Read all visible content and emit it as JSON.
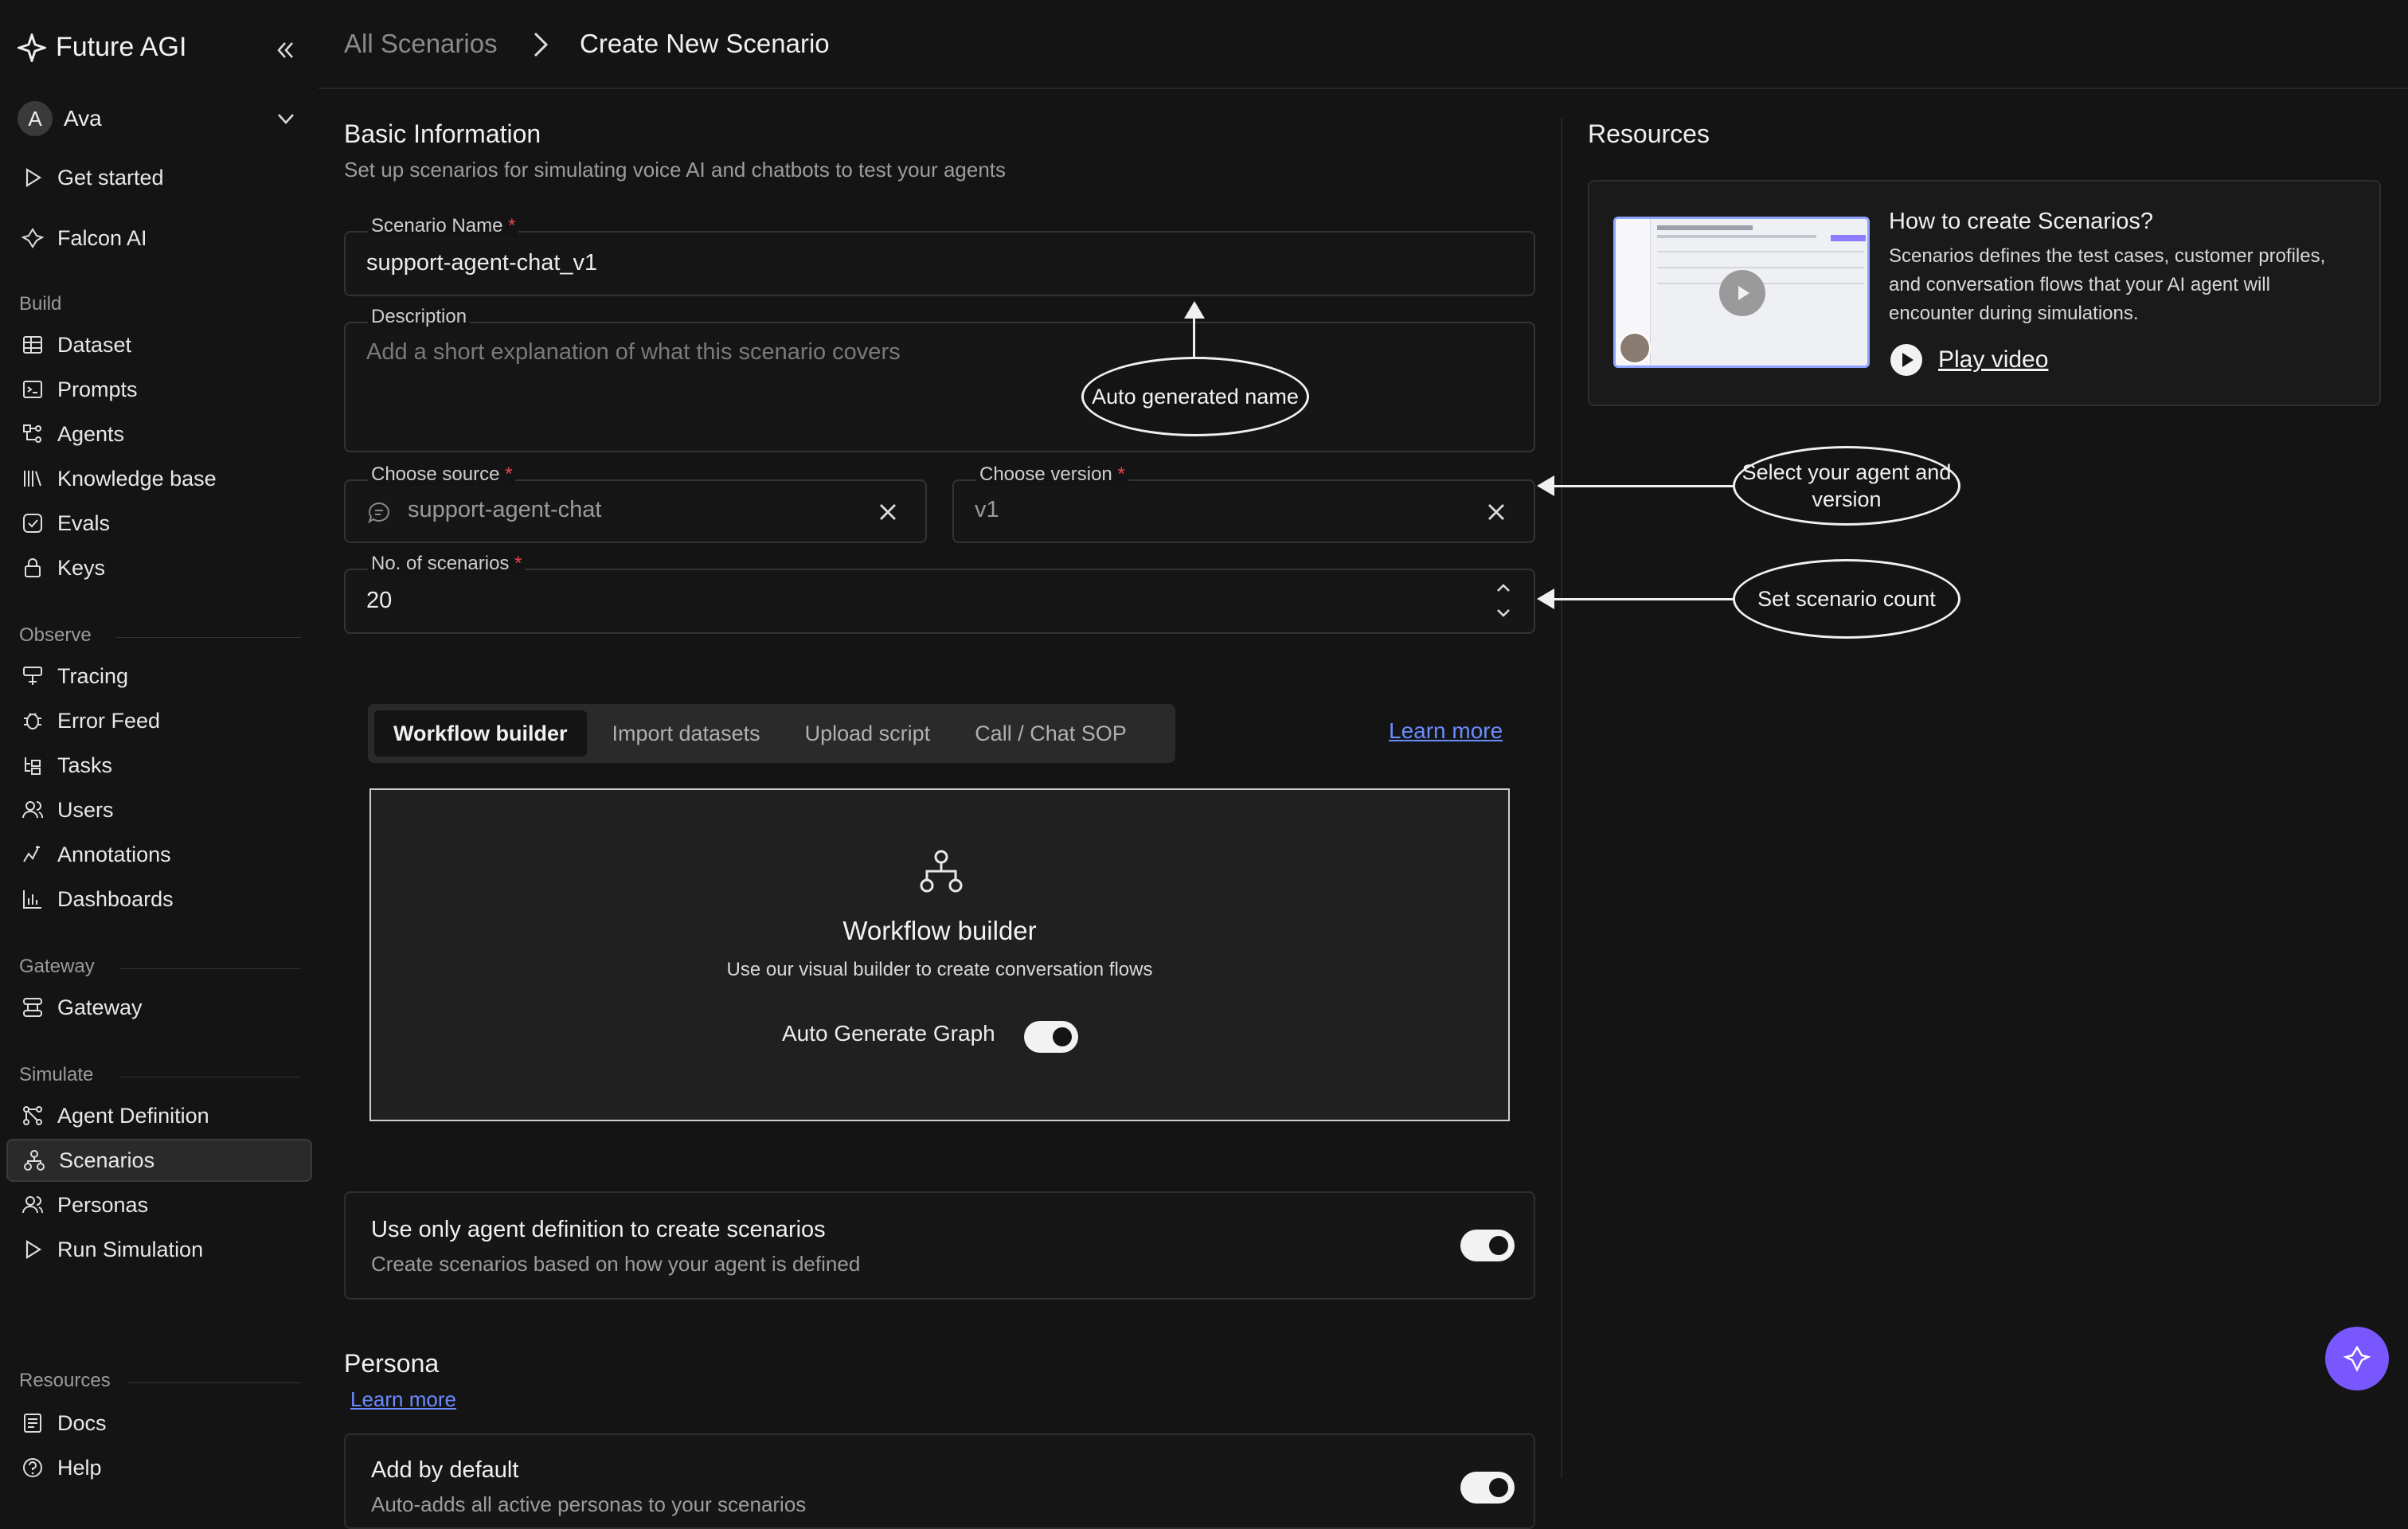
{
  "app": {
    "name": "Future AGI"
  },
  "user": {
    "initial": "A",
    "name": "Ava"
  },
  "nav": {
    "get_started": "Get started",
    "falcon": "Falcon AI",
    "build_label": "Build",
    "build": [
      "Dataset",
      "Prompts",
      "Agents",
      "Knowledge base",
      "Evals",
      "Keys"
    ],
    "observe_label": "Observe",
    "observe": [
      "Tracing",
      "Error Feed",
      "Tasks",
      "Users",
      "Annotations",
      "Dashboards"
    ],
    "gateway_label": "Gateway",
    "gateway": [
      "Gateway"
    ],
    "simulate_label": "Simulate",
    "simulate": [
      "Agent Definition",
      "Scenarios",
      "Personas",
      "Run Simulation"
    ],
    "resources_label": "Resources",
    "resources": [
      "Docs",
      "Help"
    ]
  },
  "breadcrumb": {
    "parent": "All Scenarios",
    "current": "Create New Scenario"
  },
  "basic": {
    "title": "Basic Information",
    "subtitle": "Set up scenarios for simulating voice AI and chatbots to test your agents",
    "name_label": "Scenario Name",
    "name_value": "support-agent-chat_v1",
    "desc_label": "Description",
    "desc_placeholder": "Add a short explanation of what this scenario covers",
    "source_label": "Choose source",
    "source_value": "support-agent-chat",
    "version_label": "Choose version",
    "version_value": "v1",
    "count_label": "No. of scenarios",
    "count_value": "20",
    "required_mark": "*"
  },
  "tabs": {
    "items": [
      "Workflow builder",
      "Import datasets",
      "Upload script",
      "Call / Chat SOP"
    ],
    "learn_more": "Learn more"
  },
  "builder": {
    "title": "Workflow builder",
    "desc": "Use our visual builder to create conversation flows",
    "toggle_label": "Auto Generate Graph",
    "toggle_on": true
  },
  "agent_def": {
    "title": "Use only agent definition to create scenarios",
    "desc": "Create scenarios based on how your agent is defined",
    "toggle_on": true
  },
  "persona": {
    "title": "Persona",
    "learn_more": "Learn more",
    "add_default_title": "Add by default",
    "add_default_desc": "Auto-adds all active personas to your scenarios",
    "toggle_on": true
  },
  "resources": {
    "title": "Resources",
    "card_title": "How to create Scenarios?",
    "card_desc": "Scenarios defines the test cases, customer profiles, and conversation flows that your AI agent will encounter during simulations.",
    "play": "Play video"
  },
  "callouts": {
    "auto_name": "Auto generated name",
    "select_agent": "Select your agent and version",
    "set_count": "Set scenario count"
  },
  "colors": {
    "accent": "#7857ff",
    "link": "#6b8cff",
    "required": "#e5484d",
    "bg": "#141414"
  }
}
